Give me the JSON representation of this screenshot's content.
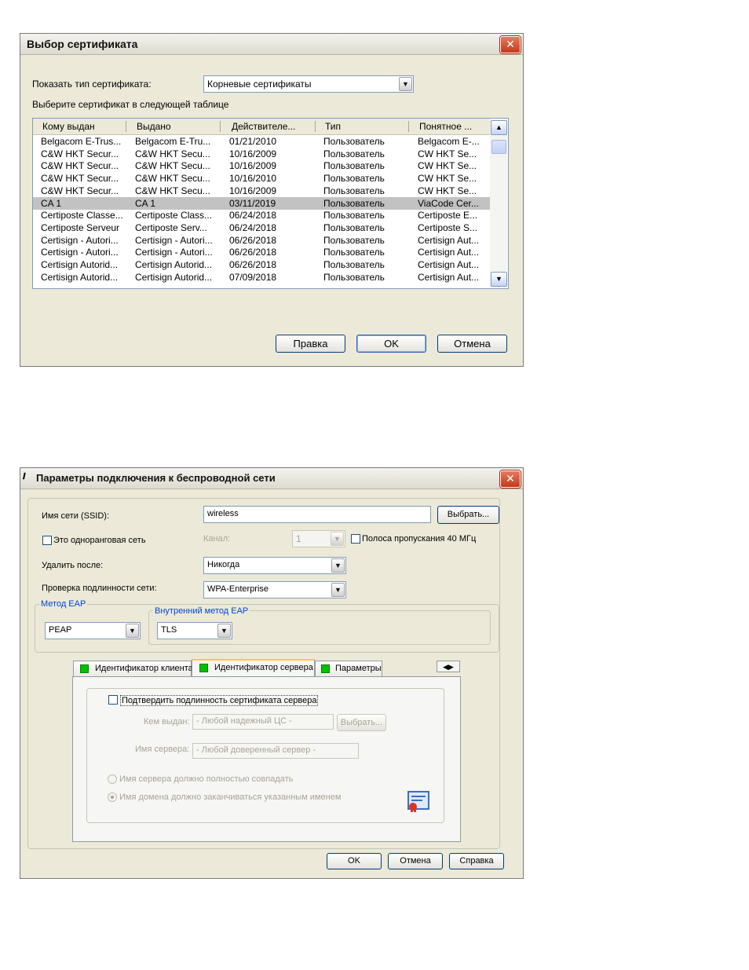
{
  "dialog1": {
    "title": "Выбор сертификата",
    "type_label": "Показать тип сертификата:",
    "type_value": "Корневые сертификаты",
    "instruction": "Выберите сертификат в следующей таблице",
    "columns": [
      "Кому выдан",
      "Выдано",
      "Действителе...",
      "Тип",
      "Понятное ..."
    ],
    "rows": [
      [
        "Belgacom E-Trus...",
        "Belgacom E-Tru...",
        "01/21/2010",
        "Пользователь",
        "Belgacom E-..."
      ],
      [
        "C&W HKT Secur...",
        "C&W HKT Secu...",
        "10/16/2009",
        "Пользователь",
        "CW HKT Se..."
      ],
      [
        "C&W HKT Secur...",
        "C&W HKT Secu...",
        "10/16/2009",
        "Пользователь",
        "CW HKT Se..."
      ],
      [
        "C&W HKT Secur...",
        "C&W HKT Secu...",
        "10/16/2010",
        "Пользователь",
        "CW HKT Se..."
      ],
      [
        "C&W HKT Secur...",
        "C&W HKT Secu...",
        "10/16/2009",
        "Пользователь",
        "CW HKT Se..."
      ],
      [
        "CA 1",
        "CA 1",
        "03/11/2019",
        "Пользователь",
        "ViaCode Cer..."
      ],
      [
        "Certiposte Classe...",
        "Certiposte Class...",
        "06/24/2018",
        "Пользователь",
        "Certiposte E..."
      ],
      [
        "Certiposte Serveur",
        "Certiposte Serv...",
        "06/24/2018",
        "Пользователь",
        "Certiposte S..."
      ],
      [
        "Certisign - Autori...",
        "Certisign - Autori...",
        "06/26/2018",
        "Пользователь",
        "Certisign Aut..."
      ],
      [
        "Certisign - Autori...",
        "Certisign - Autori...",
        "06/26/2018",
        "Пользователь",
        "Certisign Aut..."
      ],
      [
        "Certisign Autorid...",
        "Certisign Autorid...",
        "06/26/2018",
        "Пользователь",
        "Certisign Aut..."
      ],
      [
        "Certisign Autorid...",
        "Certisign Autorid...",
        "07/09/2018",
        "Пользователь",
        "Certisign Aut..."
      ]
    ],
    "selected_row": 5,
    "buttons": {
      "edit": "Правка",
      "ok": "OK",
      "cancel": "Отмена"
    }
  },
  "dialog2": {
    "title": "Параметры подключения к беспроводной сети",
    "ssid_label": "Имя сети (SSID):",
    "ssid_value": "wireless",
    "select_button": "Выбрать...",
    "adhoc_label": "Это одноранговая сеть",
    "channel_label": "Канал:",
    "channel_value": "1",
    "bandwidth_label": "Полоса пропускания 40 МГц",
    "delete_after_label": "Удалить после:",
    "delete_after_value": "Никогда",
    "auth_label": "Проверка подлинности сети:",
    "auth_value": "WPA-Enterprise",
    "eap_group": "Метод EAP",
    "eap_value": "PEAP",
    "inner_group": "Внутренний метод EAP",
    "inner_value": "TLS",
    "tabs": [
      "Идентификатор клиента",
      "Идентификатор сервера",
      "Параметры"
    ],
    "active_tab": 1,
    "verify_label": "Подтвердить подлинность сертификата сервера",
    "issuer_label": "Кем выдан:",
    "issuer_value": "- Любой надежный ЦС -",
    "issuer_button": "Выбрать...",
    "server_label": "Имя сервера:",
    "server_value": "- Любой доверенный сервер -",
    "radio_exact": "Имя сервера должно полностью совпадать",
    "radio_domain": "Имя домена должно заканчиваться указанным именем",
    "buttons": {
      "ok": "OK",
      "cancel": "Отмена",
      "help": "Справка"
    }
  }
}
